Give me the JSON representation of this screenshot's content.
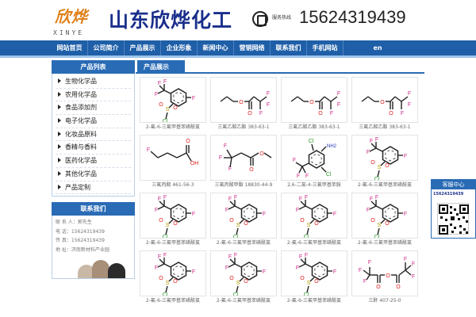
{
  "header": {
    "logo_cn": "欣烨",
    "logo_en": "XINYE",
    "company": "山东欣烨化工",
    "hotline_label": "服务热线",
    "phone": "15624319439"
  },
  "nav": {
    "items": [
      "网站首页",
      "公司简介",
      "产品展示",
      "企业形象",
      "新闻中心",
      "营销网络",
      "联系我们",
      "手机网站"
    ],
    "lang": "en"
  },
  "sidebar": {
    "title": "产品列表",
    "items": [
      "生物化学品",
      "农用化学品",
      "食品添加剂",
      "电子化学品",
      "化妆品原料",
      "香精与香料",
      "医药化学品",
      "其他化学品",
      "产品定制"
    ]
  },
  "contact": {
    "title": "联系我们",
    "lines": [
      "联 系 人：郭先生",
      "电 话：15624319439",
      "传 真：15624319439",
      "地 址：济南新材料产业园"
    ]
  },
  "main": {
    "title": "产品展示",
    "products": [
      {
        "caption": "2-氟-6-三氟甲基苯磺酰氯",
        "structure": "sulfonyl"
      },
      {
        "caption": "三氟乙酸乙酯 383-63-1",
        "structure": "ester"
      },
      {
        "caption": "三氟乙酸乙酯 383-63-1",
        "structure": "ester"
      },
      {
        "caption": "三氟乙酸乙酯 383-63-1",
        "structure": "ester"
      },
      {
        "caption": "三氟丙酸 461-56-3",
        "structure": "acid"
      },
      {
        "caption": "三氟丙酸甲酯 18830-44-9",
        "structure": "methylester"
      },
      {
        "caption": "2,6-二氯-4-三氟甲基苯胺",
        "structure": "aniline"
      },
      {
        "caption": "2-氟-6-三氟甲基苯磺酰氯",
        "structure": "sulfonyl"
      },
      {
        "caption": "2-氟-6-三氟甲基苯磺酰氯",
        "structure": "sulfonyl"
      },
      {
        "caption": "2-氟-6-三氟甲基苯磺酰氯",
        "structure": "sulfonyl"
      },
      {
        "caption": "2-氟-6-三氟甲基苯磺酰氯",
        "structure": "sulfonyl"
      },
      {
        "caption": "2-氟-6-三氟甲基苯磺酰氯",
        "structure": "sulfonyl"
      },
      {
        "caption": "2-氟-6-三氟甲基苯磺酰氯",
        "structure": "sulfonyl"
      },
      {
        "caption": "2-氟-6-三氟甲基苯磺酰氯",
        "structure": "sulfonyl"
      },
      {
        "caption": "2-氟-6-三氟甲基苯磺酰氯",
        "structure": "sulfonyl"
      },
      {
        "caption": "三酐 407-25-0",
        "structure": "anhydride"
      }
    ]
  },
  "float_service": {
    "title": "客服中心",
    "phone": "15624319439"
  },
  "colors": {
    "nav_blue": "#1f5fa8",
    "title_blue": "#2a6bb5",
    "company_text": "#1a2f8c",
    "logo_orange": "#e0801a",
    "fluorine": "#cc2a8a",
    "oxygen": "#e02020",
    "chlorine": "#2a9a2a"
  }
}
